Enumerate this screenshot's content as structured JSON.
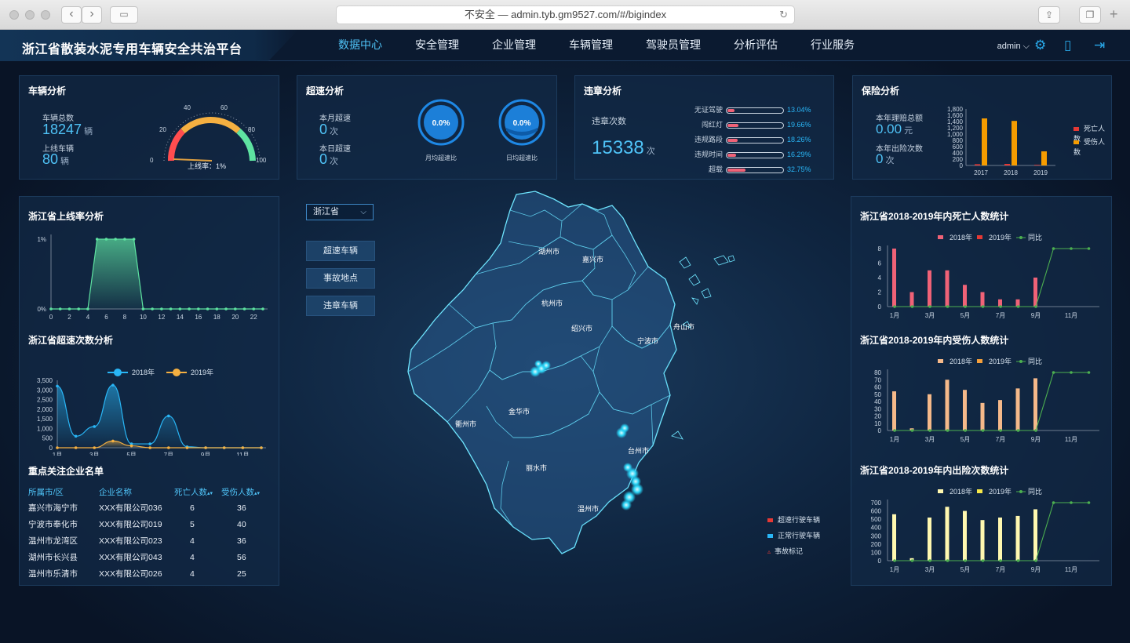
{
  "browser": {
    "url": "不安全 — admin.tyb.gm9527.com/#/bigindex"
  },
  "app": {
    "title": "浙江省散装水泥专用车辆安全共治平台",
    "nav": [
      "数据中心",
      "安全管理",
      "企业管理",
      "车辆管理",
      "驾驶员管理",
      "分析评估",
      "行业服务"
    ],
    "active_nav": "数据中心",
    "user": "admin"
  },
  "vehicle": {
    "title": "车辆分析",
    "total_label": "车辆总数",
    "total": "18247",
    "online_label": "上线车辆",
    "online": "80",
    "unit": "辆",
    "gauge_caption": "上线率：1%",
    "gauge_value": 1,
    "gauge_ticks": [
      "0",
      "20",
      "40",
      "60",
      "80",
      "100"
    ]
  },
  "speeding": {
    "title": "超速分析",
    "month_label": "本月超速",
    "month": "0",
    "today_label": "本日超速",
    "today": "0",
    "unit": "次",
    "ring1_value": "0.0%",
    "ring1_label": "月均超速比",
    "ring2_value": "0.0%",
    "ring2_label": "日均超速比"
  },
  "violation": {
    "title": "违章分析",
    "count_label": "违章次数",
    "count": "15338",
    "unit": "次",
    "items": [
      {
        "label": "无证驾驶",
        "pct": "13.04%",
        "value": 13.04
      },
      {
        "label": "闯红灯",
        "pct": "19.66%",
        "value": 19.66
      },
      {
        "label": "违规路段",
        "pct": "18.26%",
        "value": 18.26
      },
      {
        "label": "违规时间",
        "pct": "16.29%",
        "value": 16.29
      },
      {
        "label": "超载",
        "pct": "32.75%",
        "value": 32.75
      }
    ]
  },
  "insurance": {
    "title": "保险分析",
    "amount_label": "本年理赔总额",
    "amount": "0.00",
    "amount_unit": "元",
    "count_label": "本年出险次数",
    "count": "0",
    "count_unit": "次",
    "legend": [
      "死亡人数",
      "受伤人数"
    ]
  },
  "map": {
    "select_value": "浙江省",
    "buttons": [
      "超速车辆",
      "事故地点",
      "违章车辆"
    ],
    "cities": [
      "湖州市",
      "嘉兴市",
      "杭州市",
      "绍兴市",
      "宁波市",
      "舟山市",
      "衢州市",
      "金华市",
      "台州市",
      "丽水市",
      "温州市"
    ],
    "legend": [
      "超速行驶车辆",
      "正常行驶车辆",
      "事故标记"
    ]
  },
  "online_rate": {
    "title": "浙江省上线率分析"
  },
  "speed_count": {
    "title": "浙江省超速次数分析"
  },
  "companies": {
    "title": "重点关注企业名单",
    "headers": [
      "所属市/区",
      "企业名称",
      "死亡人数",
      "受伤人数"
    ],
    "rows": [
      [
        "嘉兴市海宁市",
        "XXX有限公司036",
        "6",
        "36"
      ],
      [
        "宁波市奉化市",
        "XXX有限公司019",
        "5",
        "40"
      ],
      [
        "温州市龙湾区",
        "XXX有限公司023",
        "4",
        "36"
      ],
      [
        "湖州市长兴县",
        "XXX有限公司043",
        "4",
        "56"
      ],
      [
        "温州市乐清市",
        "XXX有限公司026",
        "4",
        "25"
      ]
    ]
  },
  "right_titles": {
    "death": "浙江省2018-2019年内死亡人数统计",
    "injury": "浙江省2018-2019年内受伤人数统计",
    "claims": "浙江省2018-2019年内出险次数统计"
  },
  "chart_data": [
    {
      "type": "line",
      "title": "浙江省上线率分析",
      "x": [
        0,
        1,
        2,
        3,
        4,
        5,
        6,
        7,
        8,
        9,
        10,
        11,
        12,
        13,
        14,
        15,
        16,
        17,
        18,
        19,
        20,
        21,
        22,
        23
      ],
      "xticks": [
        "0",
        "2",
        "4",
        "6",
        "8",
        "10",
        "12",
        "14",
        "16",
        "18",
        "20",
        "22"
      ],
      "yticks": [
        "0%",
        "1%"
      ],
      "values": [
        0,
        0,
        0,
        0,
        0,
        1,
        1,
        1,
        1,
        1,
        0,
        0,
        0,
        0,
        0,
        0,
        0,
        0,
        0,
        0,
        0,
        0,
        0,
        0
      ],
      "ylim": [
        0,
        1
      ]
    },
    {
      "type": "line",
      "title": "浙江省超速次数分析",
      "x": [
        1,
        2,
        3,
        4,
        5,
        6,
        7,
        8,
        9,
        10,
        11,
        12
      ],
      "xticks": [
        "1月",
        "3月",
        "5月",
        "7月",
        "9月",
        "11月"
      ],
      "yticks": [
        "0",
        "500",
        "1,000",
        "1,500",
        "2,000",
        "2,500",
        "3,000",
        "3,500"
      ],
      "ylim": [
        0,
        3500
      ],
      "series": [
        {
          "name": "2018年",
          "color": "#29b6f6",
          "values": [
            3200,
            600,
            1100,
            3250,
            200,
            200,
            1650,
            50,
            0,
            0,
            0,
            0
          ]
        },
        {
          "name": "2019年",
          "color": "#f5b041",
          "values": [
            0,
            0,
            0,
            350,
            100,
            0,
            0,
            0,
            0,
            0,
            0,
            0
          ]
        }
      ]
    },
    {
      "type": "bar",
      "title": "保险分析",
      "categories": [
        "2017",
        "2018",
        "2019"
      ],
      "yticks": [
        "0",
        "200",
        "400",
        "600",
        "800",
        "1,000",
        "1,200",
        "1,400",
        "1,600",
        "1,800"
      ],
      "ylim": [
        0,
        1800
      ],
      "series": [
        {
          "name": "死亡人数",
          "color": "#e53935",
          "values": [
            40,
            50,
            20
          ]
        },
        {
          "name": "受伤人数",
          "color": "#f59c00",
          "values": [
            1500,
            1420,
            450
          ]
        }
      ]
    },
    {
      "type": "bar",
      "title": "浙江省2018-2019年内死亡人数统计",
      "categories": [
        "1月",
        "2月",
        "3月",
        "4月",
        "5月",
        "6月",
        "7月",
        "8月",
        "9月",
        "10月",
        "11月",
        "12月"
      ],
      "xticks": [
        "1月",
        "3月",
        "5月",
        "7月",
        "9月",
        "11月"
      ],
      "yticks": [
        "0",
        "2",
        "4",
        "6",
        "8"
      ],
      "ylim": [
        0,
        8
      ],
      "series": [
        {
          "name": "2018年",
          "color": "#f06277",
          "values": [
            8,
            2,
            5,
            5,
            3,
            2,
            1,
            1,
            4,
            0,
            0,
            0
          ]
        },
        {
          "name": "2019年",
          "color": "#e53935",
          "values": [
            0,
            0,
            0,
            0,
            0,
            0,
            0,
            0,
            0,
            0,
            0,
            0
          ]
        },
        {
          "name": "同比",
          "color": "#4caf50",
          "line": true,
          "values": [
            0,
            0,
            0,
            0,
            0,
            0,
            0,
            0,
            0,
            8,
            8,
            8
          ]
        }
      ]
    },
    {
      "type": "bar",
      "title": "浙江省2018-2019年内受伤人数统计",
      "categories": [
        "1月",
        "2月",
        "3月",
        "4月",
        "5月",
        "6月",
        "7月",
        "8月",
        "9月",
        "10月",
        "11月",
        "12月"
      ],
      "xticks": [
        "1月",
        "3月",
        "5月",
        "7月",
        "9月",
        "11月"
      ],
      "yticks": [
        "0",
        "10",
        "20",
        "30",
        "40",
        "50",
        "60",
        "70",
        "80"
      ],
      "ylim": [
        0,
        80
      ],
      "series": [
        {
          "name": "2018年",
          "color": "#f5b98a",
          "values": [
            54,
            3,
            50,
            70,
            56,
            38,
            42,
            58,
            72,
            0,
            0,
            0
          ]
        },
        {
          "name": "2019年",
          "color": "#f5a03c",
          "values": [
            0,
            0,
            0,
            0,
            0,
            0,
            0,
            0,
            0,
            0,
            0,
            0
          ]
        },
        {
          "name": "同比",
          "color": "#4caf50",
          "line": true,
          "values": [
            0,
            0,
            0,
            0,
            0,
            0,
            0,
            0,
            0,
            80,
            80,
            80
          ]
        }
      ]
    },
    {
      "type": "bar",
      "title": "浙江省2018-2019年内出险次数统计",
      "categories": [
        "1月",
        "2月",
        "3月",
        "4月",
        "5月",
        "6月",
        "7月",
        "8月",
        "9月",
        "10月",
        "11月",
        "12月"
      ],
      "xticks": [
        "1月",
        "3月",
        "5月",
        "7月",
        "9月",
        "11月"
      ],
      "yticks": [
        "0",
        "100",
        "200",
        "300",
        "400",
        "500",
        "600",
        "700"
      ],
      "ylim": [
        0,
        700
      ],
      "series": [
        {
          "name": "2018年",
          "color": "#fff8b0",
          "values": [
            560,
            30,
            520,
            650,
            600,
            490,
            520,
            540,
            620,
            0,
            0,
            0
          ]
        },
        {
          "name": "2019年",
          "color": "#f7e84a",
          "values": [
            0,
            0,
            0,
            0,
            0,
            0,
            0,
            0,
            0,
            0,
            0,
            0
          ]
        },
        {
          "name": "同比",
          "color": "#4caf50",
          "line": true,
          "values": [
            0,
            0,
            0,
            0,
            0,
            0,
            0,
            0,
            0,
            700,
            700,
            700
          ]
        }
      ]
    }
  ]
}
